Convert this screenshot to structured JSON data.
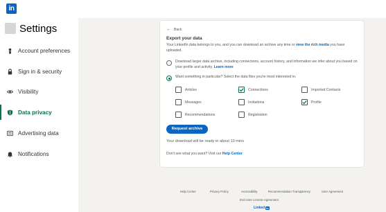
{
  "topbar": {
    "logo_text": "in"
  },
  "sidebar": {
    "title": "Settings",
    "items": [
      {
        "label": "Account preferences",
        "icon": "person-icon"
      },
      {
        "label": "Sign in & security",
        "icon": "lock-icon"
      },
      {
        "label": "Visibility",
        "icon": "eye-icon"
      },
      {
        "label": "Data privacy",
        "icon": "shield-icon",
        "active": true
      },
      {
        "label": "Advertising data",
        "icon": "newspaper-icon"
      },
      {
        "label": "Notifications",
        "icon": "bell-icon"
      }
    ]
  },
  "card": {
    "back_label": "Back",
    "title": "Export your data",
    "desc_prefix": "Your LinkedIn data belongs to you, and you can download an archive any time or ",
    "desc_link": "view the rich media",
    "desc_suffix": " you have uploaded.",
    "option1": {
      "label": "Download larger data archive, including connections, account history, and information we infer about you based on your profile and activity. ",
      "link": "Learn more",
      "checked": false
    },
    "option2": {
      "label": "Want something in particular? Select the data files you're most interested in.",
      "checked": true
    },
    "checkboxes": [
      {
        "label": "Articles",
        "checked": false
      },
      {
        "label": "Connections",
        "checked": true
      },
      {
        "label": "Imported Contacts",
        "checked": false
      },
      {
        "label": "Messages",
        "checked": false
      },
      {
        "label": "Invitations",
        "checked": false
      },
      {
        "label": "Profile",
        "checked": true
      },
      {
        "label": "Recommendations",
        "checked": false
      },
      {
        "label": "Registration",
        "checked": false
      }
    ],
    "request_button": "Request archive",
    "ready_text": "Your download will be ready in about 10 mins",
    "help_prefix": "Don't see what you want? Visit our ",
    "help_link": "Help Center"
  },
  "footer": {
    "links": [
      "Help Center",
      "Privacy Policy",
      "Accessibility",
      "Recommendation Transparency",
      "User Agreement"
    ],
    "eula": "End User License Agreement",
    "brand": "Linked",
    "brand_in": "in"
  },
  "colors": {
    "accent": "#0a66c2",
    "active_green": "#01754f",
    "background": "#f3f2ef"
  }
}
